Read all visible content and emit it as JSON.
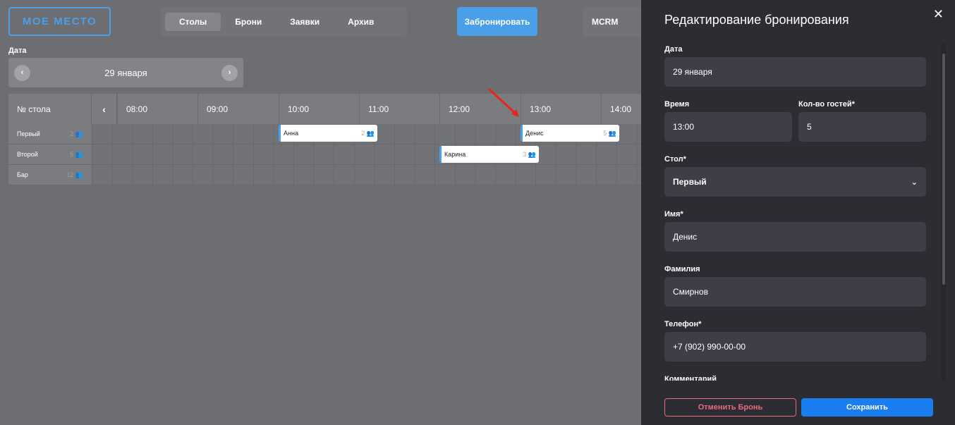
{
  "logo": "МОЕ МЕСТО",
  "tabs": [
    {
      "label": "Столы",
      "active": true
    },
    {
      "label": "Брони"
    },
    {
      "label": "Заявки"
    },
    {
      "label": "Архив"
    }
  ],
  "book_button": "Забронировать",
  "mcrm": "MCRM",
  "date_label": "Дата",
  "date_value": "29 января",
  "date_prev_icon": "chevron-left-icon",
  "date_next_icon": "chevron-right-icon",
  "grid": {
    "header": "№ стола",
    "hours": [
      "08:00",
      "09:00",
      "10:00",
      "11:00",
      "12:00",
      "13:00",
      "14:00"
    ],
    "rows": [
      {
        "name": "Первый",
        "seats": "2"
      },
      {
        "name": "Второй",
        "seats": "5"
      },
      {
        "name": "Бар",
        "seats": "12"
      }
    ],
    "bookings": [
      {
        "name": "Анна",
        "guests": "2",
        "row": 0,
        "start": "10:00",
        "end": "11:15"
      },
      {
        "name": "Денис",
        "guests": "5",
        "row": 0,
        "start": "13:00",
        "end": "14:15"
      },
      {
        "name": "Карина",
        "guests": "3",
        "row": 1,
        "start": "12:00",
        "end": "13:15"
      }
    ]
  },
  "panel": {
    "title": "Редактирование бронирования",
    "date_label": "Дата",
    "date_value": "29 января",
    "time_label": "Время",
    "time_value": "13:00",
    "guests_label": "Кол-во гостей*",
    "guests_value": "5",
    "table_label": "Стол*",
    "table_value": "Первый",
    "name_label": "Имя*",
    "name_value": "Денис",
    "surname_label": "Фамилия",
    "surname_value": "Смирнов",
    "phone_label": "Телефон*",
    "phone_value": "+7 (902) 990-00-00",
    "comment_label": "Комментарий",
    "cancel_button": "Отменить Бронь",
    "save_button": "Сохранить"
  },
  "colors": {
    "accent": "#4a9fe8",
    "save": "#1a7ef0",
    "cancel": "#e86a7a",
    "panel_bg": "#2c2d33",
    "arrow": "#e8241c"
  }
}
